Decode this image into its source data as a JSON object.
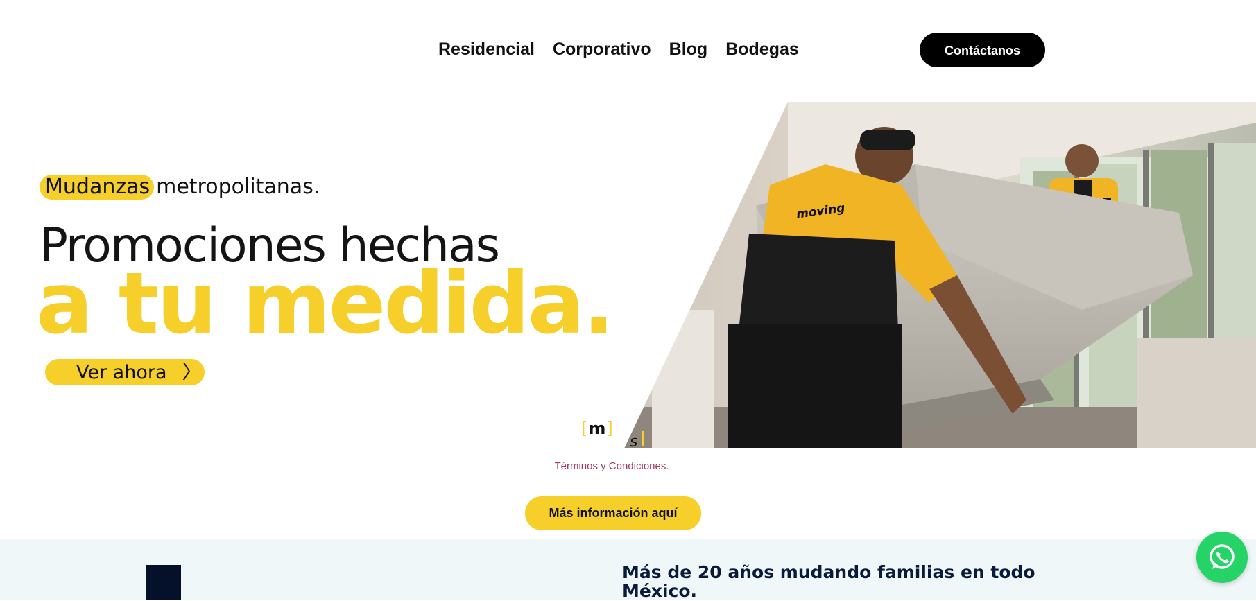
{
  "nav": {
    "items": [
      {
        "label": "Residencial"
      },
      {
        "label": "Corporativo"
      },
      {
        "label": "Blog"
      },
      {
        "label": "Bodegas"
      }
    ],
    "contact_label": "Contáctanos"
  },
  "hero": {
    "brand_highlight": "Mudanzas",
    "brand_rest": "metropolitanas.",
    "title_line1": "Promociones hechas",
    "title_line2": "a tu medida.",
    "cta_label": "Ver ahora",
    "logo_mark": "m",
    "shirt_text": "moving"
  },
  "terms_link": "Términos y Condiciones.",
  "info_button": "Más información aquí",
  "section": {
    "heading": "Más de 20 años mudando familias en todo México."
  },
  "colors": {
    "brand_yellow": "#f6cf2b",
    "dark_navy": "#05112a",
    "whatsapp_green": "#25d366",
    "terms_link": "#a03a5a"
  },
  "icons": {
    "cta_chevron": "chevron-right-icon",
    "whatsapp": "whatsapp-icon"
  }
}
